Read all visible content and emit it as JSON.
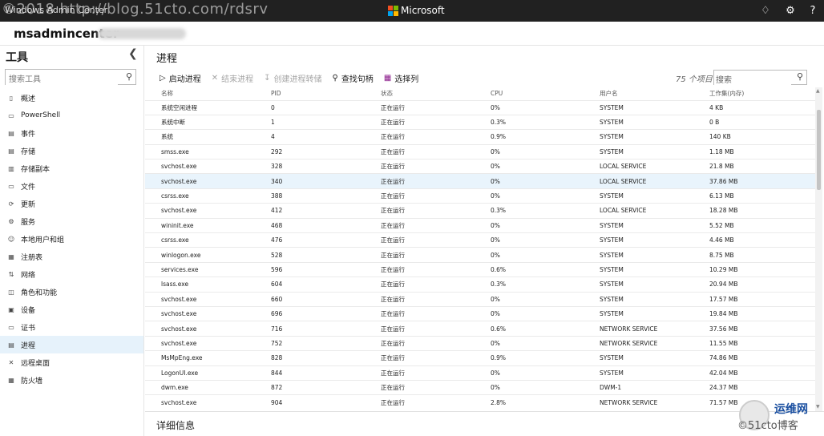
{
  "topbar": {
    "app_title": "Windows Admin Center",
    "watermark": "©2018 http://blog.51cto.com/rdsrv",
    "brand": "Microsoft",
    "logo_colors": [
      "#f25022",
      "#7fba00",
      "#00a4ef",
      "#ffb900"
    ]
  },
  "server": {
    "name": "msadmincenter"
  },
  "sidebar": {
    "title": "工具",
    "search_placeholder": "搜索工具",
    "items": [
      {
        "label": "概述",
        "icon": "overview-icon",
        "glyph": "▯"
      },
      {
        "label": "PowerShell",
        "icon": "powershell-icon",
        "glyph": "▭"
      },
      {
        "label": "事件",
        "icon": "events-icon",
        "glyph": "▤"
      },
      {
        "label": "存储",
        "icon": "storage-icon",
        "glyph": "▤"
      },
      {
        "label": "存储副本",
        "icon": "storage-replica-icon",
        "glyph": "▥"
      },
      {
        "label": "文件",
        "icon": "files-icon",
        "glyph": "▭"
      },
      {
        "label": "更新",
        "icon": "updates-icon",
        "glyph": "⟳"
      },
      {
        "label": "服务",
        "icon": "services-icon",
        "glyph": "⚙"
      },
      {
        "label": "本地用户和组",
        "icon": "users-icon",
        "glyph": "☺"
      },
      {
        "label": "注册表",
        "icon": "registry-icon",
        "glyph": "▦"
      },
      {
        "label": "网络",
        "icon": "network-icon",
        "glyph": "⇅"
      },
      {
        "label": "角色和功能",
        "icon": "roles-icon",
        "glyph": "◫"
      },
      {
        "label": "设备",
        "icon": "devices-icon",
        "glyph": "▣"
      },
      {
        "label": "证书",
        "icon": "certificates-icon",
        "glyph": "▭"
      },
      {
        "label": "进程",
        "icon": "processes-icon",
        "glyph": "▤"
      },
      {
        "label": "远程桌面",
        "icon": "remote-desktop-icon",
        "glyph": "✕"
      },
      {
        "label": "防火墙",
        "icon": "firewall-icon",
        "glyph": "▦"
      }
    ],
    "active_index": 14
  },
  "main": {
    "title": "进程",
    "toolbar": {
      "start": "启动进程",
      "end": "结束进程",
      "dump": "创建进程转储",
      "find": "查找句柄",
      "columns": "选择列"
    },
    "item_count": "75 个项目",
    "search_placeholder": "搜索",
    "columns": [
      "名称",
      "PID",
      "状态",
      "CPU",
      "用户名",
      "工作集(内存)"
    ],
    "rows": [
      [
        "系统空闲进程",
        "0",
        "正在运行",
        "0%",
        "SYSTEM",
        "4 KB"
      ],
      [
        "系统中断",
        "1",
        "正在运行",
        "0.3%",
        "SYSTEM",
        "0 B"
      ],
      [
        "系统",
        "4",
        "正在运行",
        "0.9%",
        "SYSTEM",
        "140 KB"
      ],
      [
        "smss.exe",
        "292",
        "正在运行",
        "0%",
        "SYSTEM",
        "1.18 MB"
      ],
      [
        "svchost.exe",
        "328",
        "正在运行",
        "0%",
        "LOCAL SERVICE",
        "21.8 MB"
      ],
      [
        "svchost.exe",
        "340",
        "正在运行",
        "0%",
        "LOCAL SERVICE",
        "37.86 MB"
      ],
      [
        "csrss.exe",
        "388",
        "正在运行",
        "0%",
        "SYSTEM",
        "6.13 MB"
      ],
      [
        "svchost.exe",
        "412",
        "正在运行",
        "0.3%",
        "LOCAL SERVICE",
        "18.28 MB"
      ],
      [
        "wininit.exe",
        "468",
        "正在运行",
        "0%",
        "SYSTEM",
        "5.52 MB"
      ],
      [
        "csrss.exe",
        "476",
        "正在运行",
        "0%",
        "SYSTEM",
        "4.46 MB"
      ],
      [
        "winlogon.exe",
        "528",
        "正在运行",
        "0%",
        "SYSTEM",
        "8.75 MB"
      ],
      [
        "services.exe",
        "596",
        "正在运行",
        "0.6%",
        "SYSTEM",
        "10.29 MB"
      ],
      [
        "lsass.exe",
        "604",
        "正在运行",
        "0.3%",
        "SYSTEM",
        "20.94 MB"
      ],
      [
        "svchost.exe",
        "660",
        "正在运行",
        "0%",
        "SYSTEM",
        "17.57 MB"
      ],
      [
        "svchost.exe",
        "696",
        "正在运行",
        "0%",
        "SYSTEM",
        "19.84 MB"
      ],
      [
        "svchost.exe",
        "716",
        "正在运行",
        "0.6%",
        "NETWORK SERVICE",
        "37.56 MB"
      ],
      [
        "svchost.exe",
        "752",
        "正在运行",
        "0%",
        "NETWORK SERVICE",
        "11.55 MB"
      ],
      [
        "MsMpEng.exe",
        "828",
        "正在运行",
        "0.9%",
        "SYSTEM",
        "74.86 MB"
      ],
      [
        "LogonUI.exe",
        "844",
        "正在运行",
        "0%",
        "SYSTEM",
        "42.04 MB"
      ],
      [
        "dwm.exe",
        "872",
        "正在运行",
        "0%",
        "DWM-1",
        "24.37 MB"
      ],
      [
        "svchost.exe",
        "904",
        "正在运行",
        "2.8%",
        "NETWORK SERVICE",
        "71.57 MB"
      ]
    ],
    "highlighted_row": 5,
    "details_title": "详细信息"
  },
  "badge": {
    "name": "运维网",
    "url": "©51cto博客"
  }
}
